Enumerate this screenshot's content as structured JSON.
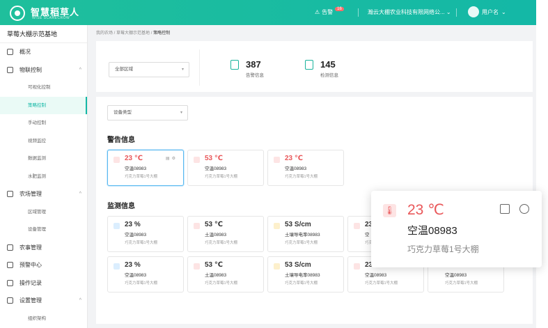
{
  "header": {
    "brand": "智慧稻草人",
    "brand_sub": "WISE SCARECROW",
    "alarm_label": "告警",
    "alarm_count": "16",
    "company": "瀚云大棚农业科技有限网络公...",
    "user": "用户名"
  },
  "sidebar": {
    "title": "草莓大棚示范基地",
    "items": [
      {
        "label": "概况"
      },
      {
        "label": "物联控制",
        "children": [
          "可视化控制",
          "策略控制",
          "手动控制",
          "视频监控",
          "数据监测",
          "水肥监测"
        ]
      },
      {
        "label": "农场管理",
        "children": [
          "区域管理",
          "设备管理"
        ]
      },
      {
        "label": "农事管理"
      },
      {
        "label": "预警中心"
      },
      {
        "label": "操作记录"
      },
      {
        "label": "设置管理",
        "children": [
          "组织架构"
        ]
      }
    ]
  },
  "breadcrumb": [
    "我的农场",
    "草莓大棚示范基地",
    "策略控制"
  ],
  "filters": {
    "area": "全部区域",
    "device_type": "设备类型"
  },
  "stats": [
    {
      "value": "387",
      "label": "告警信息"
    },
    {
      "value": "145",
      "label": "检测信息"
    }
  ],
  "warning": {
    "title": "警告信息",
    "cards": [
      {
        "value": "23 ℃",
        "name": "空温08983",
        "location": "巧克力草莓1号大棚"
      },
      {
        "value": "53 ℃",
        "name": "空温08983",
        "location": "巧克力草莓1号大棚"
      },
      {
        "value": "23 ℃",
        "name": "空温08983",
        "location": "巧克力草莓1号大棚"
      }
    ]
  },
  "monitor": {
    "title": "监测信息",
    "rows": [
      [
        {
          "value": "23 %",
          "name": "空温08983",
          "location": "巧克力草莓1号大棚"
        },
        {
          "value": "53 ℃",
          "name": "土温08983",
          "location": "巧克力草莓1号大棚"
        },
        {
          "value": "53 S/cm",
          "name": "土壤导电率08983",
          "location": "巧克力草莓1号大棚"
        },
        {
          "value": "23",
          "name": "空",
          "location": "巧克"
        }
      ],
      [
        {
          "value": "23 %",
          "name": "空温08983",
          "location": "巧克力草莓1号大棚"
        },
        {
          "value": "53 ℃",
          "name": "土温08983",
          "location": "巧克力草莓1号大棚"
        },
        {
          "value": "53 S/cm",
          "name": "土壤导电率08983",
          "location": "巧克力草莓1号大棚"
        },
        {
          "value": "23",
          "name": "空温08983",
          "location": "巧克力草莓1号大棚"
        },
        {
          "value": "",
          "name": "空温08983",
          "location": "巧克力草莓1号大棚"
        }
      ]
    ]
  },
  "popup": {
    "value": "23 ℃",
    "name": "空温08983",
    "location": "巧克力草莓1号大棚"
  },
  "colors": {
    "brand": "#14b8a6",
    "alert": "#e9585a",
    "selected_border": "#58b9f0"
  }
}
